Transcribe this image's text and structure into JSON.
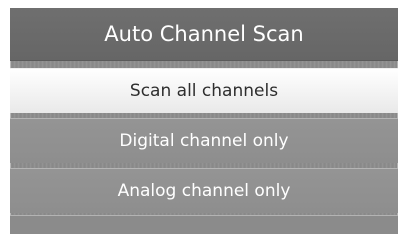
{
  "menu": {
    "title": "Auto Channel Scan",
    "items": [
      {
        "label": "Scan all channels",
        "selected": true
      },
      {
        "label": "Digital channel only",
        "selected": false
      },
      {
        "label": "Analog channel only",
        "selected": false
      }
    ]
  },
  "colors": {
    "panel_background": "#8d8d8d",
    "title_bar": "#6a6a6a",
    "selected_item_background": "#ffffff",
    "selected_item_text": "#2e2e2e",
    "item_text": "#ffffff"
  }
}
